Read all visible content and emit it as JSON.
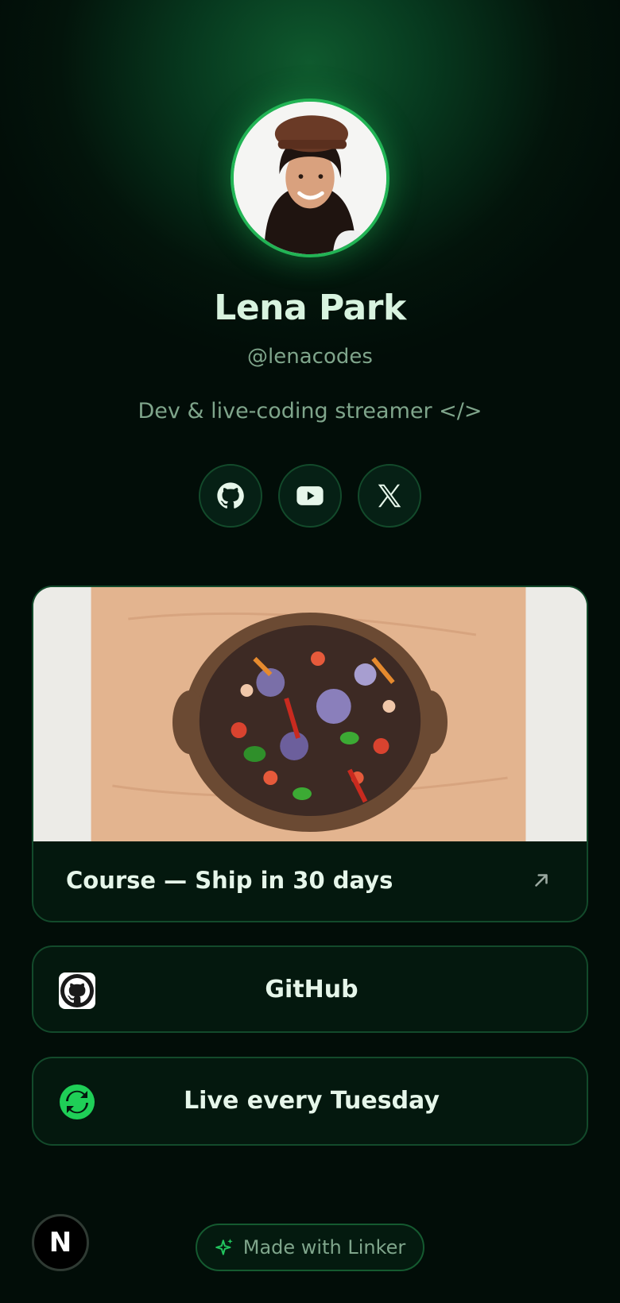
{
  "profile": {
    "name": "Lena Park",
    "handle": "@lenacodes",
    "bio": "Dev & live-coding streamer </>"
  },
  "socials": [
    {
      "icon": "github-icon"
    },
    {
      "icon": "youtube-icon"
    },
    {
      "icon": "x-icon"
    }
  ],
  "featured_card": {
    "title": "Course — Ship in 30 days",
    "icon": "arrow-up-right-icon"
  },
  "links": [
    {
      "label": "GitHub",
      "icon": "github-icon"
    },
    {
      "label": "Live every Tuesday",
      "icon": "refresh-icon"
    }
  ],
  "footer": {
    "logo_letter": "N",
    "badge_label": "Made with Linker"
  },
  "colors": {
    "accent": "#22b455",
    "background": "#020d08",
    "card_border": "#134a2b"
  }
}
